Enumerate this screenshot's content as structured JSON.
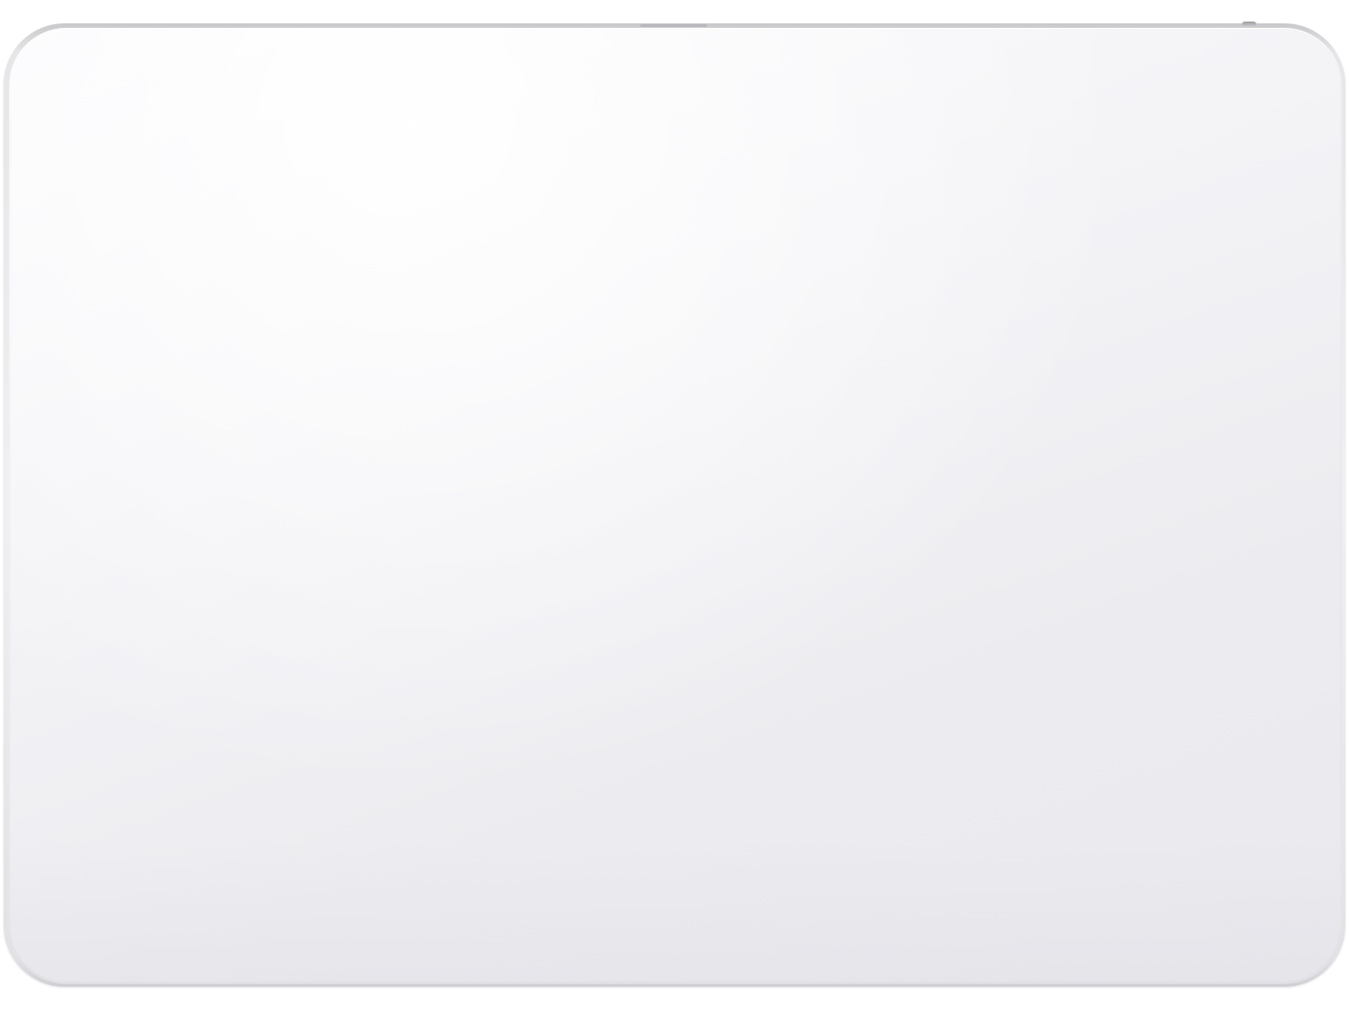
{
  "image": {
    "subject": "",
    "colors": {
      "background": "#ffffff",
      "surface": "#f1f1f4",
      "edge": "#c9c9cc"
    }
  }
}
